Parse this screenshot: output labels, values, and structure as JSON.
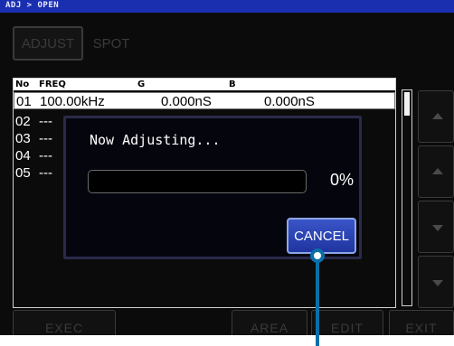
{
  "title": "ADJ > OPEN",
  "tabs": [
    {
      "label": "ADJUST"
    },
    {
      "label": "SPOT"
    }
  ],
  "table": {
    "headers": {
      "no": "No",
      "freq": "FREQ",
      "g": "G",
      "b": "B"
    },
    "rows": [
      {
        "no": "01",
        "freq": "100.00kHz",
        "g": "0.000nS",
        "b": "0.000nS"
      },
      {
        "no": "02",
        "freq": "---",
        "g": "",
        "b": ""
      },
      {
        "no": "03",
        "freq": "---",
        "g": "",
        "b": ""
      },
      {
        "no": "04",
        "freq": "---",
        "g": "",
        "b": ""
      },
      {
        "no": "05",
        "freq": "---",
        "g": "",
        "b": ""
      }
    ]
  },
  "bottom_buttons": {
    "exec": "EXEC",
    "area": "AREA",
    "edit": "EDIT",
    "exit": "EXIT"
  },
  "dialog": {
    "message": "Now Adjusting...",
    "progress_percent": 0,
    "progress_label": "0%",
    "cancel_label": "CANCEL"
  },
  "side_buttons": [
    {
      "icon": "arrow-up-icon"
    },
    {
      "icon": "arrow-up-icon"
    },
    {
      "icon": "arrow-down-icon"
    },
    {
      "icon": "arrow-down-icon"
    }
  ],
  "colors": {
    "title_bar": "#1a2fb0",
    "background": "#0b0b0b",
    "cancel_button": "#2a44b8",
    "callout": "#0a6fa8"
  }
}
